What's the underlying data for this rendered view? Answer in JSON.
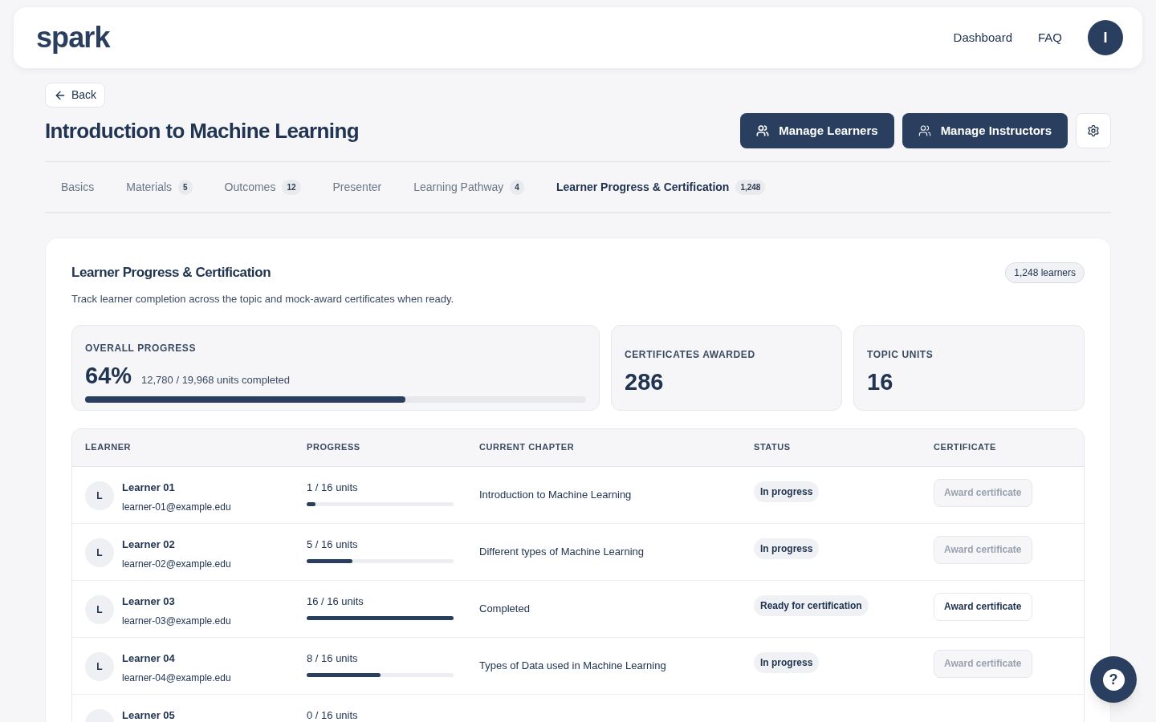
{
  "nav": {
    "logo": "spark",
    "links": [
      "Dashboard",
      "FAQ"
    ],
    "avatar": "I"
  },
  "back": "Back",
  "title": "Introduction to Machine Learning",
  "actions": [
    {
      "kind": "learners",
      "label": "Manage Learners"
    },
    {
      "kind": "instructors",
      "label": "Manage Instructors"
    },
    {
      "kind": "settings"
    }
  ],
  "tabs": [
    {
      "label": "Basics",
      "selected": false
    },
    {
      "label": "Materials",
      "count": "5",
      "selected": false
    },
    {
      "label": "Outcomes",
      "count": "12",
      "selected": false
    },
    {
      "label": "Presenter",
      "selected": false
    },
    {
      "label": "Learning Pathway",
      "count": "4",
      "selected": false
    },
    {
      "label": "Learner Progress & Certification",
      "count": "1,248",
      "selected": true
    }
  ],
  "panel": {
    "title": "Learner Progress & Certification",
    "badge": "1,248 learners",
    "description": "Track learner completion across the topic and mock-award certificates when ready.",
    "overall": {
      "label": "OVERALL PROGRESS",
      "value": "64%",
      "detail": "12,780 / 19,968 units completed",
      "level": 0.64
    },
    "stats": [
      {
        "label": "CERTIFICATES AWARDED",
        "value": "286"
      },
      {
        "label": "TOPIC UNITS",
        "value": "16"
      }
    ]
  },
  "table": {
    "columns": [
      "LEARNER",
      "PROGRESS",
      "CURRENT CHAPTER",
      "STATUS",
      "CERTIFICATE"
    ],
    "rows": [
      {
        "initial": "L",
        "name": "Learner 01",
        "email": "learner-01@example.edu",
        "progress": "1 / 16 units",
        "level": 0.0625,
        "chapter": "Introduction to Machine Learning",
        "status": "In progress",
        "action": "Award certificate",
        "disabled": true
      },
      {
        "initial": "L",
        "name": "Learner 02",
        "email": "learner-02@example.edu",
        "progress": "5 / 16 units",
        "level": 0.3125,
        "chapter": "Different types of Machine Learning",
        "status": "In progress",
        "action": "Award certificate",
        "disabled": true
      },
      {
        "initial": "L",
        "name": "Learner 03",
        "email": "learner-03@example.edu",
        "progress": "16 / 16 units",
        "level": 1,
        "chapter": "Completed",
        "status": "Ready for certification",
        "action": "Award certificate",
        "disabled": false
      },
      {
        "initial": "L",
        "name": "Learner 04",
        "email": "learner-04@example.edu",
        "progress": "8 / 16 units",
        "level": 0.5,
        "chapter": "Types of Data used in Machine Learning",
        "status": "In progress",
        "action": "Award certificate",
        "disabled": true
      },
      {
        "name": "Learner 05",
        "progress": "0 / 16 units"
      }
    ]
  },
  "help": "?"
}
